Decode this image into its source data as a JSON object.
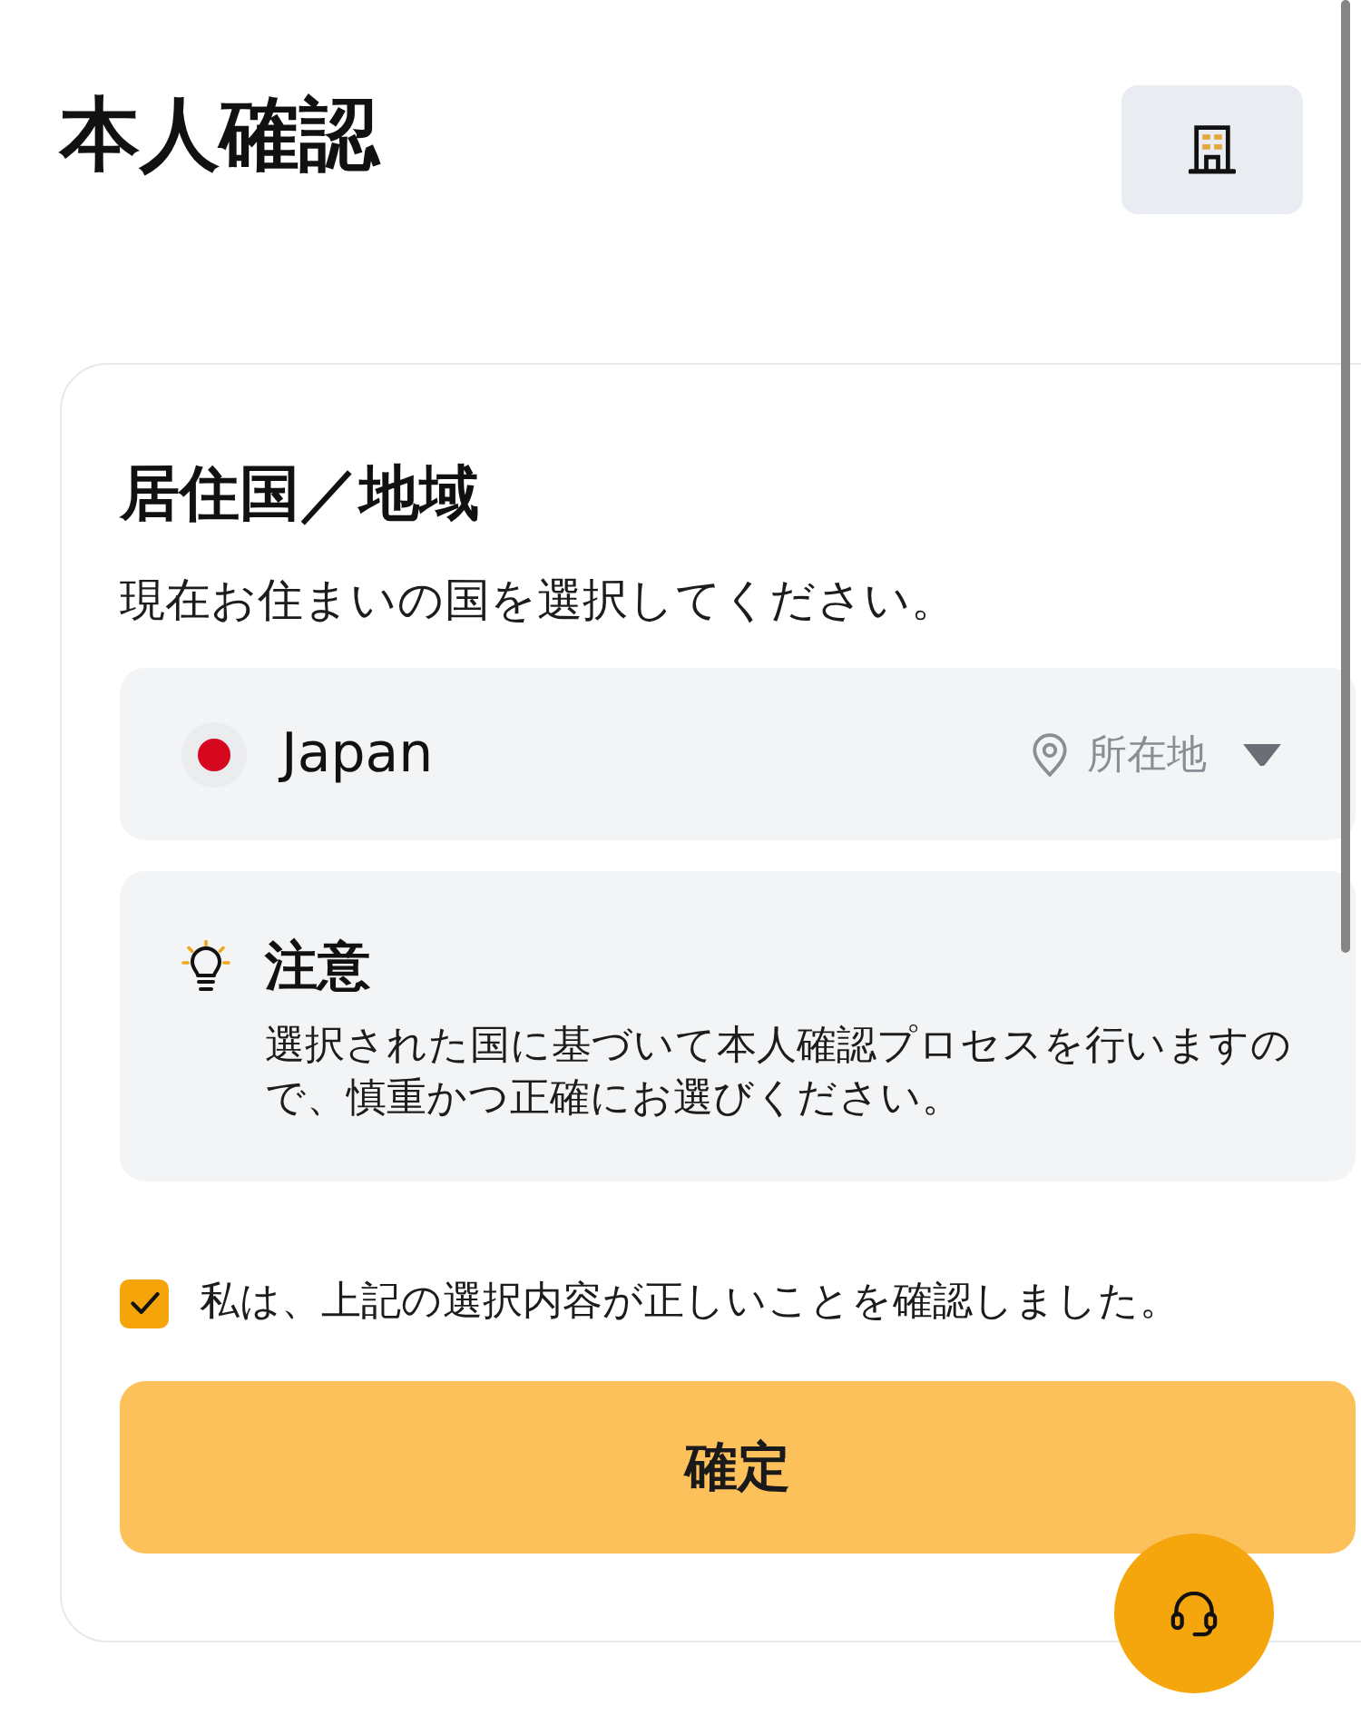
{
  "header": {
    "title": "本人確認"
  },
  "residence": {
    "heading": "居住国／地域",
    "description": "現在お住まいの国を選択してください。",
    "country": {
      "name": "Japan",
      "location_label": "所在地"
    },
    "notice": {
      "title": "注意",
      "body": "選択された国に基づいて本人確認プロセスを行いますので、慎重かつ正確にお選びください。"
    },
    "agreement": {
      "label": "私は、上記の選択内容が正しいことを確認しました。",
      "checked": true
    },
    "confirm_button": {
      "label": "確定"
    }
  }
}
